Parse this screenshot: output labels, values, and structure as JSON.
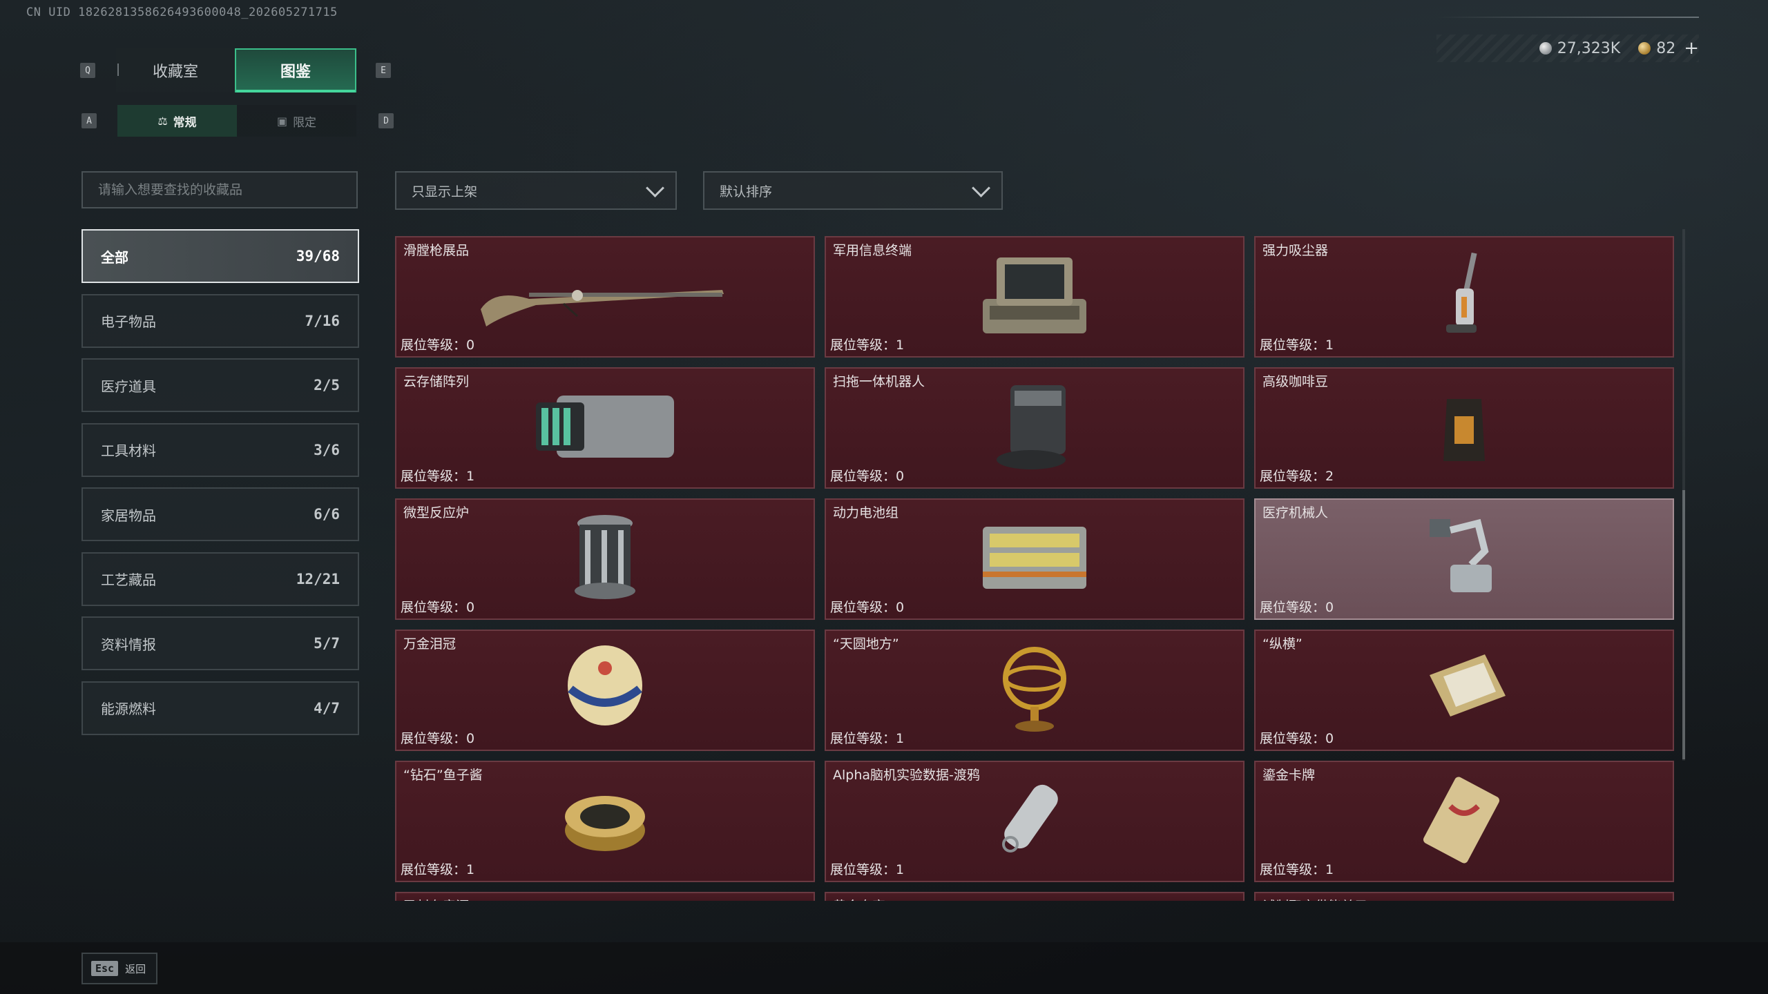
{
  "uid_text": "CN UID 1826281358626493600048_202605271715",
  "currency": {
    "silver": "27,323K",
    "gold": "82",
    "plus": "+"
  },
  "keys": {
    "q": "Q",
    "e": "E",
    "a": "A",
    "d": "D"
  },
  "main_tabs": [
    {
      "label": "收藏室",
      "active": false
    },
    {
      "label": "图鉴",
      "active": true
    }
  ],
  "sub_tabs": [
    {
      "label": "常规",
      "icon": "flask-icon",
      "active": true
    },
    {
      "label": "限定",
      "icon": "image-icon",
      "active": false
    }
  ],
  "search": {
    "placeholder": "请输入想要查找的收藏品"
  },
  "filters": {
    "shelf": "只显示上架",
    "sort": "默认排序"
  },
  "categories": [
    {
      "label": "全部",
      "count": "39/68",
      "active": true
    },
    {
      "label": "电子物品",
      "count": "7/16",
      "active": false
    },
    {
      "label": "医疗道具",
      "count": "2/5",
      "active": false
    },
    {
      "label": "工具材料",
      "count": "3/6",
      "active": false
    },
    {
      "label": "家居物品",
      "count": "6/6",
      "active": false
    },
    {
      "label": "工艺藏品",
      "count": "12/21",
      "active": false
    },
    {
      "label": "资料情报",
      "count": "5/7",
      "active": false
    },
    {
      "label": "能源燃料",
      "count": "4/7",
      "active": false
    }
  ],
  "level_prefix": "展位等级：",
  "items": [
    {
      "name": "滑膛枪展品",
      "level": "0",
      "icon": "musket-icon"
    },
    {
      "name": "军用信息终端",
      "level": "1",
      "icon": "terminal-case-icon"
    },
    {
      "name": "强力吸尘器",
      "level": "1",
      "icon": "vacuum-icon"
    },
    {
      "name": "云存储阵列",
      "level": "1",
      "icon": "server-array-icon"
    },
    {
      "name": "扫拖一体机器人",
      "level": "0",
      "icon": "robot-vacuum-icon"
    },
    {
      "name": "高级咖啡豆",
      "level": "2",
      "icon": "coffee-bag-icon"
    },
    {
      "name": "微型反应炉",
      "level": "0",
      "icon": "reactor-icon"
    },
    {
      "name": "动力电池组",
      "level": "0",
      "icon": "battery-pack-icon"
    },
    {
      "name": "医疗机械人",
      "level": "0",
      "icon": "medical-robot-icon",
      "highlight": true
    },
    {
      "name": "万金泪冠",
      "level": "0",
      "icon": "jeweled-egg-icon"
    },
    {
      "name": "“天圆地方”",
      "level": "1",
      "icon": "armillary-sphere-icon"
    },
    {
      "name": "“纵横”",
      "level": "0",
      "icon": "chessboard-icon"
    },
    {
      "name": "“钻石”鱼子酱",
      "level": "1",
      "icon": "caviar-tin-icon"
    },
    {
      "name": "Alpha脑机实验数据-渡鸦",
      "level": "1",
      "icon": "data-capsule-icon"
    },
    {
      "name": "鎏金卡牌",
      "level": "1",
      "icon": "gold-card-icon"
    },
    {
      "name": "已封存音源",
      "level": "",
      "icon": "",
      "partial": true
    },
    {
      "name": "黄金鸟窝",
      "level": "",
      "icon": "",
      "partial": true
    },
    {
      "name": "试制聚变供能单元",
      "level": "",
      "icon": "",
      "partial": true
    }
  ],
  "footer": {
    "esc_key": "Esc",
    "esc_label": "返回"
  },
  "colors": {
    "accent": "#3bbf8a",
    "card_bg": "#4a1c24",
    "card_highlight": "#7a6068"
  }
}
